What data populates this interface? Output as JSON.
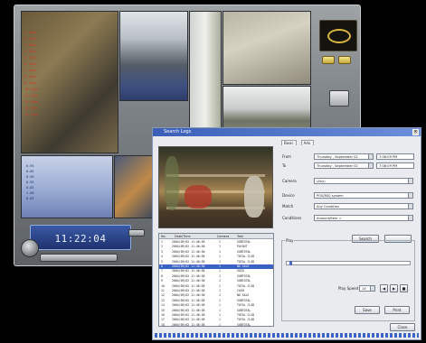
{
  "dvr": {
    "clock_label": "",
    "clock_time": "11:22:04",
    "overlay": {
      "header": "* * * * * * *",
      "items": [
        "1 Item",
        "2 Item",
        "3 Item",
        "4 Item",
        "5 Item",
        "6 Item",
        "7 Item",
        "8 Item",
        "9 Item",
        "10 Item",
        "11 Item",
        "12 Item",
        "13 Item",
        "14 Item"
      ],
      "prices": [
        "0.99",
        "1.49",
        "2.79",
        "0.59",
        "3.29",
        "1.19",
        "0.89"
      ]
    },
    "register_rows": [
      "0.95",
      "0.85",
      "0.90",
      "0.95",
      "0.85",
      "1.00",
      "0.85"
    ],
    "accent": "#3b5aa6"
  },
  "dialog": {
    "title": "Search Logs",
    "tabs": [
      "Basic",
      "Adv."
    ],
    "fields": [
      {
        "label": "From",
        "value_date": "Thursday , September 02",
        "value_time": "7:08:09 PM"
      },
      {
        "label": "To",
        "value_date": "Thursday , September 02",
        "value_time": "7:08:09 PM"
      },
      {
        "label": "Camera",
        "value_date": "(Any)"
      },
      {
        "label": "Device",
        "value_date": "POS/RS0 system"
      },
      {
        "label": "Match",
        "value_date": "Any Condition"
      },
      {
        "label": "Conditions",
        "value_date": "Amount/Item  ="
      }
    ],
    "search_button": "Search",
    "play": {
      "caption": "Play",
      "speed_label": "Play Speed",
      "speed_value": "1X",
      "position_fraction": 0.02
    },
    "save_button": "Save",
    "print_button": "Print",
    "close_button": "Close",
    "results": {
      "columns": [
        "No.",
        "Date/Time",
        "Camera",
        "Text"
      ],
      "rows": [
        {
          "no": "1",
          "dt": "2004/09/02 11:46:58",
          "cam": "1",
          "text": "SUBTOTAL"
        },
        {
          "no": "2",
          "dt": "2004/09/02 11:46:58",
          "cam": "1",
          "text": "PAYOUT"
        },
        {
          "no": "3",
          "dt": "2004/09/02 11:46:58",
          "cam": "1",
          "text": "SUBTOTAL"
        },
        {
          "no": "4",
          "dt": "2004/09/02 11:46:58",
          "cam": "1",
          "text": "TOTAL CLSD"
        },
        {
          "no": "5",
          "dt": "2004/09/02 11:46:58",
          "cam": "1",
          "text": "TOTAL CLSD"
        },
        {
          "no": "6",
          "dt": "2004/09/02 11:46:58",
          "cam": "1",
          "text": "NO SALE"
        },
        {
          "no": "7",
          "dt": "2004/09/02 11:46:58",
          "cam": "1",
          "text": "VOID"
        },
        {
          "no": "8",
          "dt": "2004/09/02 11:46:58",
          "cam": "1",
          "text": "SUBTOTAL"
        },
        {
          "no": "9",
          "dt": "2004/09/02 11:46:58",
          "cam": "1",
          "text": "SUBTOTAL"
        },
        {
          "no": "10",
          "dt": "2004/09/02 11:46:58",
          "cam": "1",
          "text": "TOTAL CLSD"
        },
        {
          "no": "11",
          "dt": "2004/09/02 11:46:58",
          "cam": "1",
          "text": "CASH"
        },
        {
          "no": "12",
          "dt": "2004/09/02 11:46:58",
          "cam": "1",
          "text": "NO SALE"
        },
        {
          "no": "13",
          "dt": "2004/09/02 11:46:58",
          "cam": "1",
          "text": "SUBTOTAL"
        },
        {
          "no": "14",
          "dt": "2004/09/02 11:46:58",
          "cam": "1",
          "text": "TOTAL CLSD"
        },
        {
          "no": "15",
          "dt": "2004/09/02 11:46:58",
          "cam": "1",
          "text": "SUBTOTAL"
        },
        {
          "no": "16",
          "dt": "2004/09/02 11:46:58",
          "cam": "1",
          "text": "TOTAL CLSD"
        },
        {
          "no": "17",
          "dt": "2004/09/02 11:46:58",
          "cam": "1",
          "text": "TOTAL CLSD"
        },
        {
          "no": "18",
          "dt": "2004/09/02 11:46:58",
          "cam": "1",
          "text": "SUBTOTAL"
        }
      ],
      "selected_index": 5,
      "selection_color": "#3a62c4"
    }
  }
}
